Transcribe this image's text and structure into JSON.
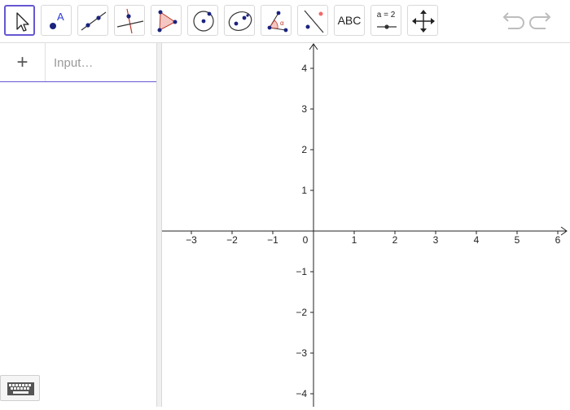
{
  "toolbar": {
    "tools": [
      {
        "name": "move-tool",
        "active": true
      },
      {
        "name": "point-tool"
      },
      {
        "name": "line-tool"
      },
      {
        "name": "perpendicular-line-tool"
      },
      {
        "name": "polygon-tool"
      },
      {
        "name": "circle-tool"
      },
      {
        "name": "conic-tool"
      },
      {
        "name": "angle-tool"
      },
      {
        "name": "reflect-tool"
      },
      {
        "name": "text-tool",
        "label": "ABC"
      },
      {
        "name": "slider-tool",
        "label": "a = 2"
      },
      {
        "name": "move-graphics-view-tool"
      }
    ],
    "undo_icon": "undo-icon",
    "redo_icon": "redo-icon"
  },
  "algebra": {
    "add_label": "+",
    "input_placeholder": "Input…",
    "keyboard_icon": "keyboard-icon"
  },
  "graphics": {
    "x_ticks": [
      "−3",
      "−2",
      "−1",
      "0",
      "1",
      "2",
      "3",
      "4",
      "5",
      "6"
    ],
    "y_ticks": [
      "4",
      "3",
      "2",
      "1",
      "−1",
      "−2",
      "−3",
      "−4"
    ]
  },
  "colors": {
    "accent": "#6557d2",
    "point": "#1a237e",
    "shape_fill": "#f4c7c3",
    "shape_stroke": "#c0392b"
  }
}
